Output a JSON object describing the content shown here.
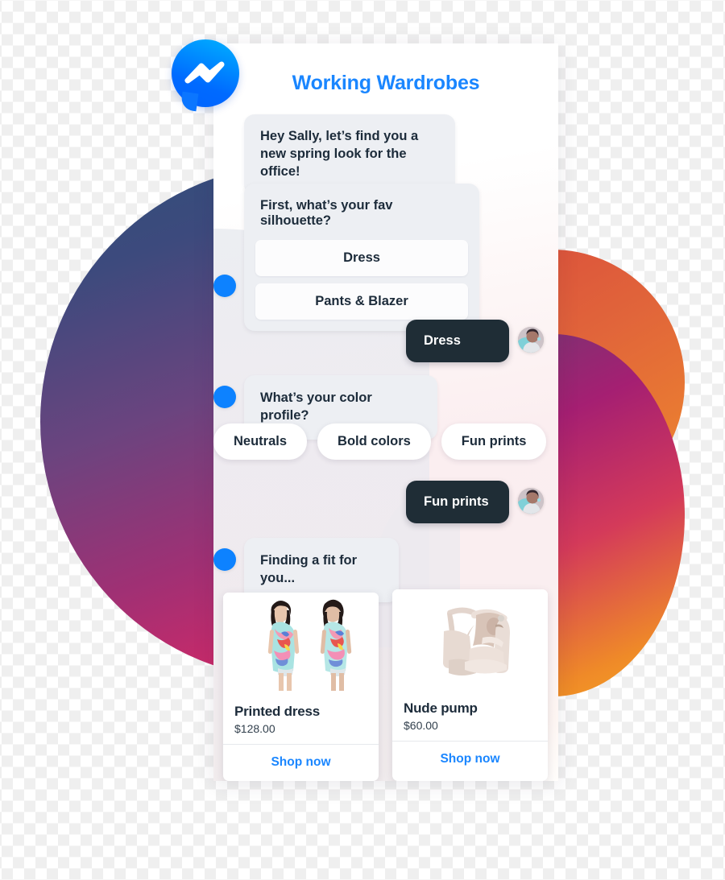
{
  "brand": {
    "logo_icon": "messenger-logo-icon",
    "accent_blue": "#0d82ff",
    "title_blue": "#1a86ff",
    "user_bubble_dark": "#1f2d36",
    "bot_bubble_grey": "#edeff3"
  },
  "header": {
    "title": "Working Wardrobes"
  },
  "conversation": [
    {
      "id": "greeting",
      "sender": "bot",
      "text": "Hey Sally, let’s find you a new spring look for the office!"
    },
    {
      "id": "silhouette-question",
      "sender": "bot",
      "text": "First, what’s your fav silhouette?",
      "options": [
        "Dress",
        "Pants & Blazer"
      ]
    },
    {
      "id": "reply-dress",
      "sender": "user",
      "text": "Dress"
    },
    {
      "id": "color-question",
      "sender": "bot",
      "text": "What’s your color profile?"
    },
    {
      "id": "color-quick-replies",
      "sender": "bot",
      "quick_replies": [
        "Neutrals",
        "Bold colors",
        "Fun prints"
      ]
    },
    {
      "id": "reply-fun-prints",
      "sender": "user",
      "text": "Fun prints"
    },
    {
      "id": "finding-fit",
      "sender": "bot",
      "text": "Finding a fit for you..."
    }
  ],
  "messages": {
    "greeting": "Hey Sally, let’s find you a new spring look for the office!",
    "silhouette_question": "First, what’s your fav silhouette?",
    "option_dress": "Dress",
    "option_pants_blazer": "Pants & Blazer",
    "reply_dress": "Dress",
    "color_question": "What’s your color profile?",
    "reply_fun_prints": "Fun prints",
    "finding_fit": "Finding a fit for you..."
  },
  "quick_replies": [
    {
      "label": "Neutrals"
    },
    {
      "label": "Bold colors"
    },
    {
      "label": "Fun prints"
    }
  ],
  "products": [
    {
      "name": "Printed dress",
      "price": "$128.00",
      "cta": "Shop now",
      "image": "printed-floral-dress-photo"
    },
    {
      "name": "Nude pump",
      "price": "$60.00",
      "cta": "Shop now",
      "image": "nude-block-heel-pump-photo"
    }
  ],
  "avatar": {
    "alt": "user-avatar"
  }
}
